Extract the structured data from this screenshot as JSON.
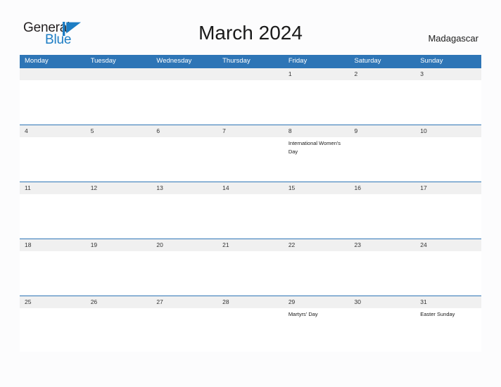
{
  "brand": {
    "name_part1": "General",
    "name_part2": "Blue",
    "logo_icon": "triangle-flag-icon",
    "accent_color": "#1d7dc4"
  },
  "header": {
    "title": "March 2024",
    "country": "Madagascar"
  },
  "calendar": {
    "header_bg": "#2e75b6",
    "band_bg": "#f0f0f0",
    "weekdays": [
      "Monday",
      "Tuesday",
      "Wednesday",
      "Thursday",
      "Friday",
      "Saturday",
      "Sunday"
    ],
    "weeks": [
      {
        "days": [
          {
            "date": "",
            "event": ""
          },
          {
            "date": "",
            "event": ""
          },
          {
            "date": "",
            "event": ""
          },
          {
            "date": "",
            "event": ""
          },
          {
            "date": "1",
            "event": ""
          },
          {
            "date": "2",
            "event": ""
          },
          {
            "date": "3",
            "event": ""
          }
        ]
      },
      {
        "days": [
          {
            "date": "4",
            "event": ""
          },
          {
            "date": "5",
            "event": ""
          },
          {
            "date": "6",
            "event": ""
          },
          {
            "date": "7",
            "event": ""
          },
          {
            "date": "8",
            "event": "International Women's Day"
          },
          {
            "date": "9",
            "event": ""
          },
          {
            "date": "10",
            "event": ""
          }
        ]
      },
      {
        "days": [
          {
            "date": "11",
            "event": ""
          },
          {
            "date": "12",
            "event": ""
          },
          {
            "date": "13",
            "event": ""
          },
          {
            "date": "14",
            "event": ""
          },
          {
            "date": "15",
            "event": ""
          },
          {
            "date": "16",
            "event": ""
          },
          {
            "date": "17",
            "event": ""
          }
        ]
      },
      {
        "days": [
          {
            "date": "18",
            "event": ""
          },
          {
            "date": "19",
            "event": ""
          },
          {
            "date": "20",
            "event": ""
          },
          {
            "date": "21",
            "event": ""
          },
          {
            "date": "22",
            "event": ""
          },
          {
            "date": "23",
            "event": ""
          },
          {
            "date": "24",
            "event": ""
          }
        ]
      },
      {
        "days": [
          {
            "date": "25",
            "event": ""
          },
          {
            "date": "26",
            "event": ""
          },
          {
            "date": "27",
            "event": ""
          },
          {
            "date": "28",
            "event": ""
          },
          {
            "date": "29",
            "event": "Martyrs' Day"
          },
          {
            "date": "30",
            "event": ""
          },
          {
            "date": "31",
            "event": "Easter Sunday"
          }
        ]
      }
    ]
  }
}
